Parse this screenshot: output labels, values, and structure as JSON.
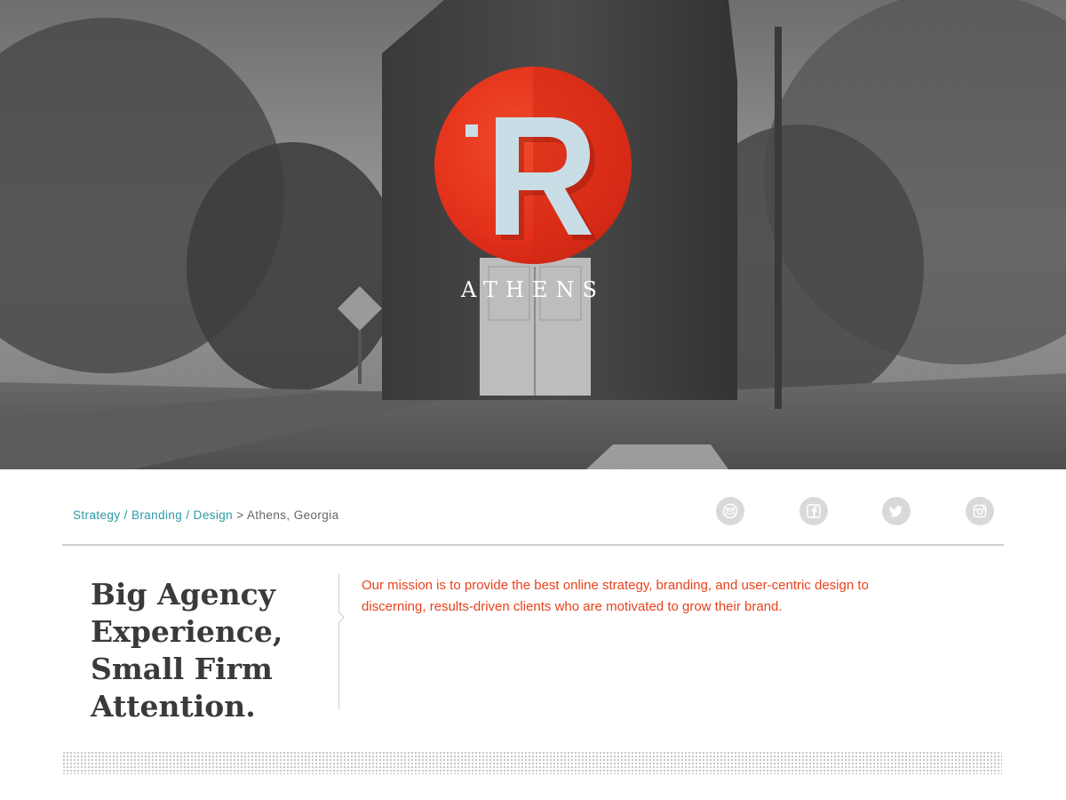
{
  "hero": {
    "logo_letter": "R",
    "logo_text": "ATHENS",
    "colors": {
      "logo_red": "#e8301a",
      "logo_letter": "#c9dde6"
    }
  },
  "breadcrumb": {
    "links": [
      "Strategy",
      "Branding",
      "Design"
    ],
    "separator": "/",
    "arrow": ">",
    "location": "Athens, Georgia"
  },
  "social": [
    {
      "name": "email",
      "icon": "mail-icon"
    },
    {
      "name": "facebook",
      "icon": "facebook-icon"
    },
    {
      "name": "twitter",
      "icon": "twitter-icon"
    },
    {
      "name": "instagram",
      "icon": "instagram-icon"
    }
  ],
  "content": {
    "headline_lines": [
      "Big Agency",
      "Experience,",
      "Small Firm",
      "Attention."
    ],
    "mission": "Our mission is to provide the best online strategy, branding, and user-centric design to discerning, results-driven clients who are motivated to grow their brand.",
    "colors": {
      "mission_text": "#e8421c",
      "link": "#2a9aa8",
      "headline": "#3a3a3a"
    }
  }
}
